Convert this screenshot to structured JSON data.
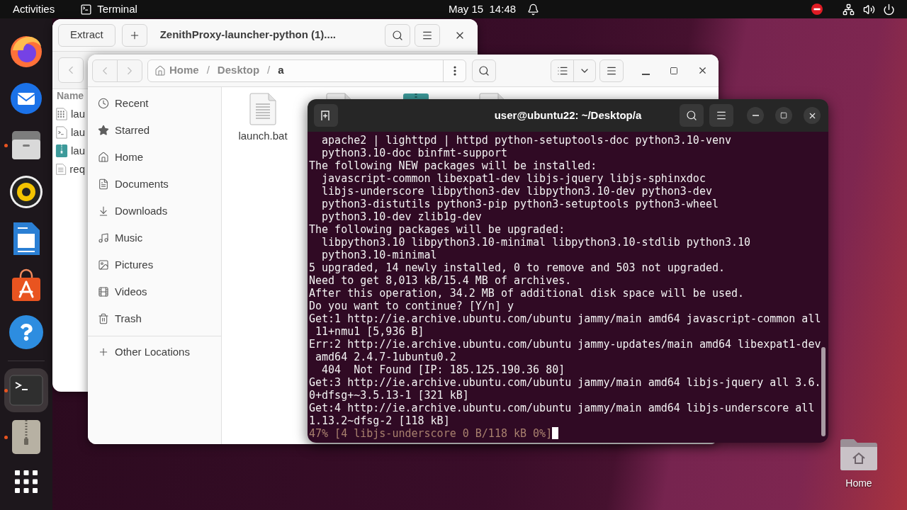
{
  "top_bar": {
    "activities": "Activities",
    "app_menu": "Terminal",
    "clock": "May 15  14:48"
  },
  "dock": {
    "pinned": [
      {
        "kind": "browser",
        "running": false,
        "selected": false
      },
      {
        "kind": "mail",
        "running": false,
        "selected": false
      },
      {
        "kind": "files",
        "running": true,
        "selected": false
      },
      {
        "kind": "player",
        "running": false,
        "selected": false
      },
      {
        "kind": "writer",
        "running": false,
        "selected": false
      },
      {
        "kind": "store",
        "running": false,
        "selected": false
      },
      {
        "kind": "help",
        "running": false,
        "selected": false
      }
    ],
    "others": [
      {
        "kind": "terminal",
        "running": true,
        "selected": true
      },
      {
        "kind": "archiver",
        "running": true,
        "selected": false
      }
    ]
  },
  "archive_window": {
    "extract_button": "Extract",
    "title": "ZenithProxy-launcher-python (1)....",
    "list_header": "Name",
    "rows": [
      {
        "kind": "binary",
        "name": "lau"
      },
      {
        "kind": "script",
        "name": "lau"
      },
      {
        "kind": "zip",
        "name": "lau"
      },
      {
        "kind": "text",
        "name": "req"
      }
    ]
  },
  "files_window": {
    "path": [
      {
        "kind": "home",
        "label": "Home",
        "selected": false
      },
      {
        "kind": "separator",
        "label": "/"
      },
      {
        "kind": "folder",
        "label": "Desktop",
        "selected": false
      },
      {
        "kind": "separator",
        "label": "/"
      },
      {
        "kind": "folder",
        "label": "a",
        "selected": true
      }
    ],
    "sidebar": [
      {
        "kind": "recent",
        "label": "Recent",
        "selected": false
      },
      {
        "kind": "starred",
        "label": "Starred",
        "selected": false
      },
      {
        "kind": "home",
        "label": "Home",
        "selected": false
      },
      {
        "kind": "documents",
        "label": "Documents",
        "selected": false
      },
      {
        "kind": "downloads",
        "label": "Downloads",
        "selected": false
      },
      {
        "kind": "music",
        "label": "Music",
        "selected": false
      },
      {
        "kind": "pictures",
        "label": "Pictures",
        "selected": false
      },
      {
        "kind": "videos",
        "label": "Videos",
        "selected": false
      },
      {
        "kind": "trash",
        "label": "Trash",
        "selected": false
      }
    ],
    "other_locations": "Other Locations",
    "files": [
      {
        "kind": "document",
        "name": "launch.bat"
      },
      {
        "kind": "document"
      },
      {
        "kind": "archive"
      },
      {
        "kind": "document"
      }
    ]
  },
  "terminal": {
    "title": "user@ubuntu22: ~/Desktop/a",
    "lines": [
      {
        "kind": "output",
        "text": "  apache2 | lighttpd | httpd python-setuptools-doc python3.10-venv"
      },
      {
        "kind": "output",
        "text": "  python3.10-doc binfmt-support"
      },
      {
        "kind": "output",
        "text": "The following NEW packages will be installed:"
      },
      {
        "kind": "output",
        "text": "  javascript-common libexpat1-dev libjs-jquery libjs-sphinxdoc"
      },
      {
        "kind": "output",
        "text": "  libjs-underscore libpython3-dev libpython3.10-dev python3-dev"
      },
      {
        "kind": "output",
        "text": "  python3-distutils python3-pip python3-setuptools python3-wheel"
      },
      {
        "kind": "output",
        "text": "  python3.10-dev zlib1g-dev"
      },
      {
        "kind": "output",
        "text": "The following packages will be upgraded:"
      },
      {
        "kind": "output",
        "text": "  libpython3.10 libpython3.10-minimal libpython3.10-stdlib python3.10"
      },
      {
        "kind": "output",
        "text": "  python3.10-minimal"
      },
      {
        "kind": "output",
        "text": "5 upgraded, 14 newly installed, 0 to remove and 503 not upgraded."
      },
      {
        "kind": "output",
        "text": "Need to get 8,013 kB/15.4 MB of archives."
      },
      {
        "kind": "output",
        "text": "After this operation, 34.2 MB of additional disk space will be used."
      },
      {
        "kind": "output",
        "text": "Do you want to continue? [Y/n] y"
      },
      {
        "kind": "output",
        "text": "Get:1 http://ie.archive.ubuntu.com/ubuntu jammy/main amd64 javascript-common all"
      },
      {
        "kind": "output",
        "text": " 11+nmu1 [5,936 B]"
      },
      {
        "kind": "output",
        "text": "Err:2 http://ie.archive.ubuntu.com/ubuntu jammy-updates/main amd64 libexpat1-dev"
      },
      {
        "kind": "output",
        "text": " amd64 2.4.7-1ubuntu0.2"
      },
      {
        "kind": "output",
        "text": "  404  Not Found [IP: 185.125.190.36 80]"
      },
      {
        "kind": "output",
        "text": "Get:3 http://ie.archive.ubuntu.com/ubuntu jammy/main amd64 libjs-jquery all 3.6."
      },
      {
        "kind": "output",
        "text": "0+dfsg+~3.5.13-1 [321 kB]"
      },
      {
        "kind": "output",
        "text": "Get:4 http://ie.archive.ubuntu.com/ubuntu jammy/main amd64 libjs-underscore all"
      },
      {
        "kind": "output",
        "text": "1.13.2~dfsg-2 [118 kB]"
      },
      {
        "kind": "progress",
        "text": "47% [4 libjs-underscore 0 B/118 kB 0%]"
      }
    ],
    "cursor": true
  },
  "desktop_icons": [
    {
      "label": "Home"
    }
  ]
}
